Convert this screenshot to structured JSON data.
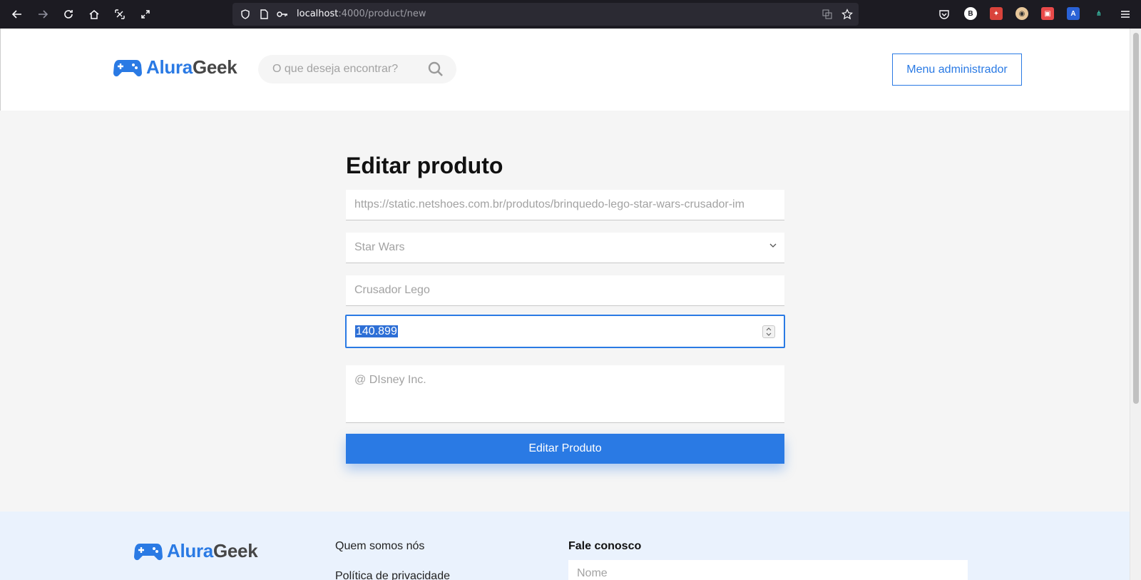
{
  "browser": {
    "url_host": "localhost",
    "url_path": ":4000/product/new"
  },
  "header": {
    "logo_part1": "Alura",
    "logo_part2": "Geek",
    "search_placeholder": "O que deseja encontrar?",
    "admin_button": "Menu administrador"
  },
  "form": {
    "title": "Editar produto",
    "image_url": "https://static.netshoes.com.br/produtos/brinquedo-lego-star-wars-crusador-im",
    "category": "Star Wars",
    "name": "Crusador Lego",
    "price": "140.899",
    "description": "@ DIsney Inc.",
    "submit_label": "Editar Produto"
  },
  "footer": {
    "logo_part1": "Alura",
    "logo_part2": "Geek",
    "links": [
      "Quem somos nós",
      "Política de privacidade"
    ],
    "contact_title": "Fale conosco",
    "name_placeholder": "Nome"
  }
}
